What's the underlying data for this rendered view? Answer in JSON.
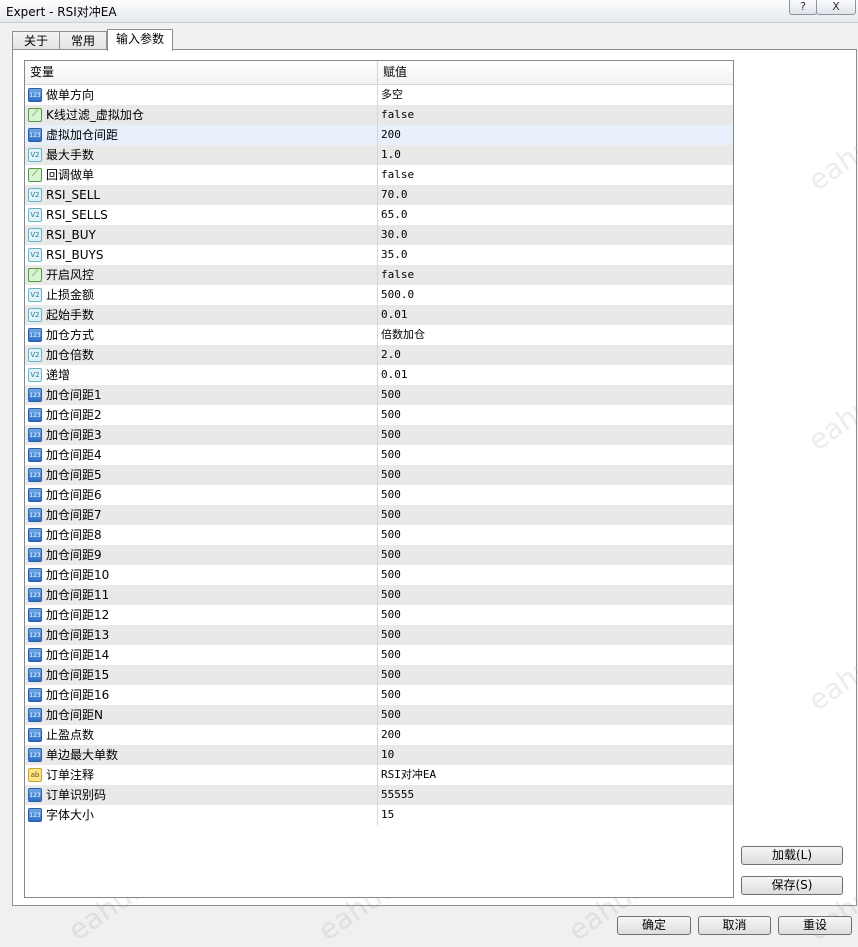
{
  "window": {
    "title": "Expert - RSI对冲EA",
    "help": "?",
    "close": "X"
  },
  "tabs": [
    {
      "label": "关于"
    },
    {
      "label": "常用"
    },
    {
      "label": "输入参数"
    }
  ],
  "grid": {
    "headers": {
      "variable": "变量",
      "value": "赋值"
    },
    "rows": [
      {
        "type": "int",
        "name": "做单方向",
        "value": "多空"
      },
      {
        "type": "bool",
        "name": "K线过滤_虚拟加仓",
        "value": "false"
      },
      {
        "type": "int",
        "name": "虚拟加仓间距",
        "value": "200"
      },
      {
        "type": "double",
        "name": "最大手数",
        "value": "1.0"
      },
      {
        "type": "bool",
        "name": "回调做单",
        "value": "false"
      },
      {
        "type": "double",
        "name": "RSI_SELL",
        "value": "70.0"
      },
      {
        "type": "double",
        "name": "RSI_SELLS",
        "value": "65.0"
      },
      {
        "type": "double",
        "name": "RSI_BUY",
        "value": "30.0"
      },
      {
        "type": "double",
        "name": "RSI_BUYS",
        "value": "35.0"
      },
      {
        "type": "bool",
        "name": "开启风控",
        "value": "false"
      },
      {
        "type": "double",
        "name": "止损金额",
        "value": "500.0"
      },
      {
        "type": "double",
        "name": "起始手数",
        "value": "0.01"
      },
      {
        "type": "int",
        "name": "加仓方式",
        "value": "倍数加仓"
      },
      {
        "type": "double",
        "name": "加仓倍数",
        "value": "2.0"
      },
      {
        "type": "double",
        "name": "递增",
        "value": "0.01"
      },
      {
        "type": "int",
        "name": "加仓间距1",
        "value": "500"
      },
      {
        "type": "int",
        "name": "加仓间距2",
        "value": "500"
      },
      {
        "type": "int",
        "name": "加仓间距3",
        "value": "500"
      },
      {
        "type": "int",
        "name": "加仓间距4",
        "value": "500"
      },
      {
        "type": "int",
        "name": "加仓间距5",
        "value": "500"
      },
      {
        "type": "int",
        "name": "加仓间距6",
        "value": "500"
      },
      {
        "type": "int",
        "name": "加仓间距7",
        "value": "500"
      },
      {
        "type": "int",
        "name": "加仓间距8",
        "value": "500"
      },
      {
        "type": "int",
        "name": "加仓间距9",
        "value": "500"
      },
      {
        "type": "int",
        "name": "加仓间距10",
        "value": "500"
      },
      {
        "type": "int",
        "name": "加仓间距11",
        "value": "500"
      },
      {
        "type": "int",
        "name": "加仓间距12",
        "value": "500"
      },
      {
        "type": "int",
        "name": "加仓间距13",
        "value": "500"
      },
      {
        "type": "int",
        "name": "加仓间距14",
        "value": "500"
      },
      {
        "type": "int",
        "name": "加仓间距15",
        "value": "500"
      },
      {
        "type": "int",
        "name": "加仓间距16",
        "value": "500"
      },
      {
        "type": "int",
        "name": "加仓间距N",
        "value": "500"
      },
      {
        "type": "int",
        "name": "止盈点数",
        "value": "200"
      },
      {
        "type": "int",
        "name": "单边最大单数",
        "value": "10"
      },
      {
        "type": "string",
        "name": "订单注释",
        "value": "RSI对冲EA"
      },
      {
        "type": "int",
        "name": "订单识别码",
        "value": "55555"
      },
      {
        "type": "int",
        "name": "字体大小",
        "value": "15"
      }
    ]
  },
  "icons": {
    "int": "123",
    "bool": "⟋",
    "double": "V2",
    "string": "ab"
  },
  "buttons": {
    "load": "加载(L)",
    "save": "保存(S)",
    "ok": "确定",
    "cancel": "取消",
    "reset": "重设"
  },
  "watermark": "eahub.cn"
}
